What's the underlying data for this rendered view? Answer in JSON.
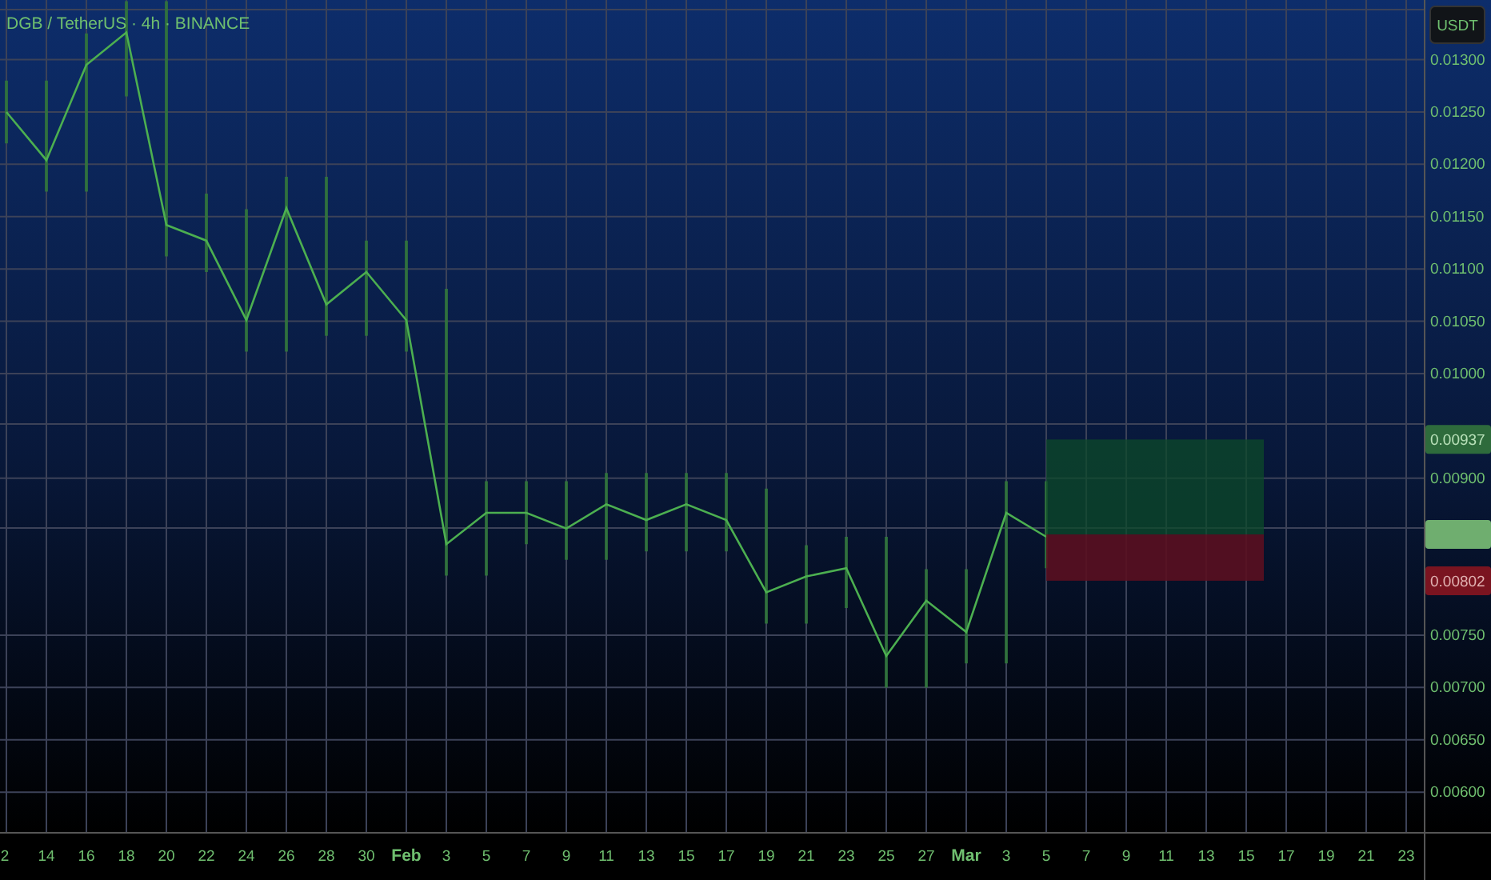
{
  "chart": {
    "title": "DGB / TetherUS · 4h · BINANCE",
    "currency": "USDT",
    "chart_data": {
      "type": "line",
      "categories": [
        "2",
        "14",
        "16",
        "18",
        "20",
        "22",
        "24",
        "26",
        "28",
        "30",
        "Feb",
        "3",
        "5",
        "7",
        "9",
        "11",
        "13",
        "15",
        "17",
        "19",
        "21",
        "23",
        "25",
        "27",
        "Mar",
        "3",
        "5",
        "7",
        "9",
        "11",
        "13",
        "15",
        "17",
        "19",
        "21",
        "23"
      ],
      "series": [
        {
          "color": "#4caf50",
          "values": [
            0.0125,
            0.01204,
            0.01295,
            0.01326,
            0.01142,
            0.01127,
            0.01051,
            0.01158,
            0.01066,
            0.01097,
            0.01051,
            0.00837,
            0.00867,
            0.00867,
            0.00852,
            0.00875,
            0.0086,
            0.00875,
            0.0086,
            0.00791,
            0.00806,
            0.00814,
            0.0073,
            0.00783,
            0.00753,
            0.00867,
            0.00844,
            null,
            null,
            null,
            null,
            null,
            null,
            null,
            null,
            null
          ]
        }
      ],
      "ylim": [
        0.00516,
        0.01357
      ],
      "yticks": [
        {
          "value": 0.013,
          "label": "0.01300"
        },
        {
          "value": 0.0125,
          "label": "0.01250"
        },
        {
          "value": 0.012,
          "label": "0.01200"
        },
        {
          "value": 0.0115,
          "label": "0.01150"
        },
        {
          "value": 0.011,
          "label": "0.01100"
        },
        {
          "value": 0.0105,
          "label": "0.01050"
        },
        {
          "value": 0.01,
          "label": "0.01000"
        },
        {
          "value": 0.009,
          "label": "0.00900"
        },
        {
          "value": 0.0075,
          "label": "0.00750"
        },
        {
          "value": 0.007,
          "label": "0.00700"
        },
        {
          "value": 0.0065,
          "label": "0.00650"
        },
        {
          "value": 0.006,
          "label": "0.00600"
        }
      ]
    }
  },
  "price_labels": [
    {
      "kind": "target",
      "text": "0.00937"
    },
    {
      "kind": "current"
    },
    {
      "kind": "stop",
      "text": "0.00802"
    }
  ]
}
